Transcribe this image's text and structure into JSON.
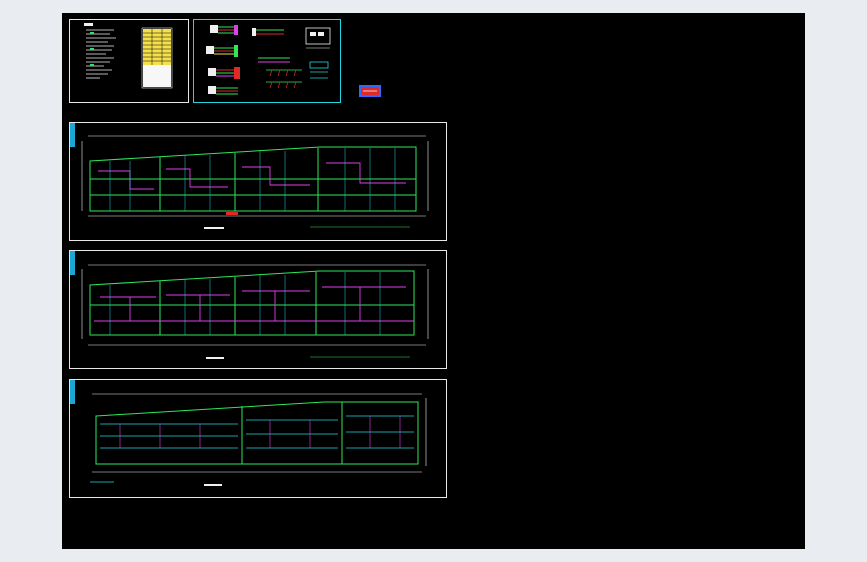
{
  "app": {
    "title": "",
    "background": "#000000",
    "frame_bg": "#e9ecf0"
  },
  "colors": {
    "sheet_border": "#e8e8e8",
    "accent_cyan": "#1aa7d6",
    "line_green": "#2ee85a",
    "line_magenta": "#e040e8",
    "line_cyan": "#23d6e0",
    "line_white": "#f0f0f0",
    "line_yellow": "#f4e04a",
    "line_red": "#e02a2a",
    "line_blue": "#2a6cff"
  },
  "sheets": [
    {
      "id": "legend-sheet",
      "kind": "notes-and-table"
    },
    {
      "id": "system-diagram-sheet",
      "kind": "system-diagram"
    },
    {
      "id": "floor-plan-1",
      "kind": "floor-plan"
    },
    {
      "id": "floor-plan-2",
      "kind": "floor-plan"
    },
    {
      "id": "floor-plan-3",
      "kind": "floor-plan"
    }
  ],
  "icons": {
    "legend-block": "red-blue-legend-swatch"
  }
}
